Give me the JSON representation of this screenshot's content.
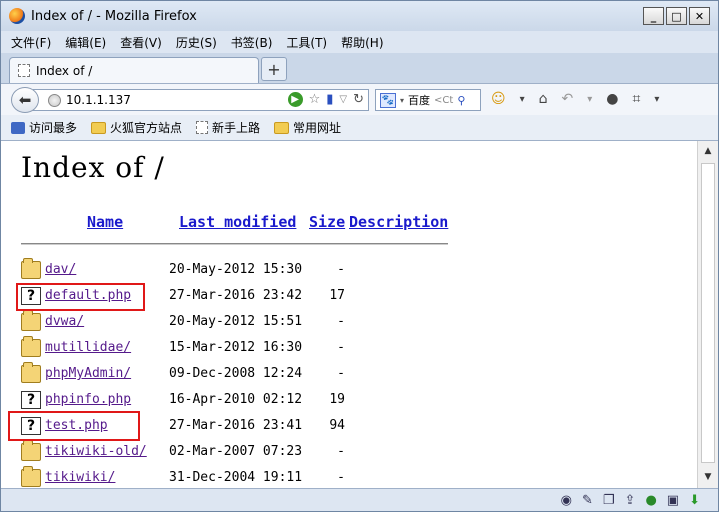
{
  "window": {
    "title": "Index of / - Mozilla Firefox"
  },
  "menu": [
    "文件(F)",
    "编辑(E)",
    "查看(V)",
    "历史(S)",
    "书签(B)",
    "工具(T)",
    "帮助(H)"
  ],
  "tab": {
    "label": "Index of /",
    "new_tab": "+"
  },
  "nav": {
    "url": "10.1.1.137",
    "search_engine": "百度",
    "search_placeholder": "<Ct"
  },
  "bookmarks": [
    "访问最多",
    "火狐官方站点",
    "新手上路",
    "常用网址"
  ],
  "page": {
    "heading": "Index of /",
    "columns": {
      "name": "Name",
      "modified": "Last modified",
      "size": "Size",
      "description": "Description"
    },
    "entries": [
      {
        "name": "dav/",
        "modified": "20-May-2012 15:30",
        "size": "-",
        "type": "folder"
      },
      {
        "name": "default.php",
        "modified": "27-Mar-2016 23:42",
        "size": "17",
        "type": "file"
      },
      {
        "name": "dvwa/",
        "modified": "20-May-2012 15:51",
        "size": "-",
        "type": "folder"
      },
      {
        "name": "mutillidae/",
        "modified": "15-Mar-2012 16:30",
        "size": "-",
        "type": "folder"
      },
      {
        "name": "phpMyAdmin/",
        "modified": "09-Dec-2008 12:24",
        "size": "-",
        "type": "folder"
      },
      {
        "name": "phpinfo.php",
        "modified": "16-Apr-2010 02:12",
        "size": "19",
        "type": "file"
      },
      {
        "name": "test.php",
        "modified": "27-Mar-2016 23:41",
        "size": "94",
        "type": "file"
      },
      {
        "name": "tikiwiki-old/",
        "modified": "02-Mar-2007 07:23",
        "size": "-",
        "type": "folder"
      },
      {
        "name": "tikiwiki/",
        "modified": "31-Dec-2004 19:11",
        "size": "-",
        "type": "folder"
      }
    ]
  },
  "colors": {
    "highlight_box": "#e01818",
    "link_header": "#1a1acc",
    "link_visited": "#551a8b"
  }
}
